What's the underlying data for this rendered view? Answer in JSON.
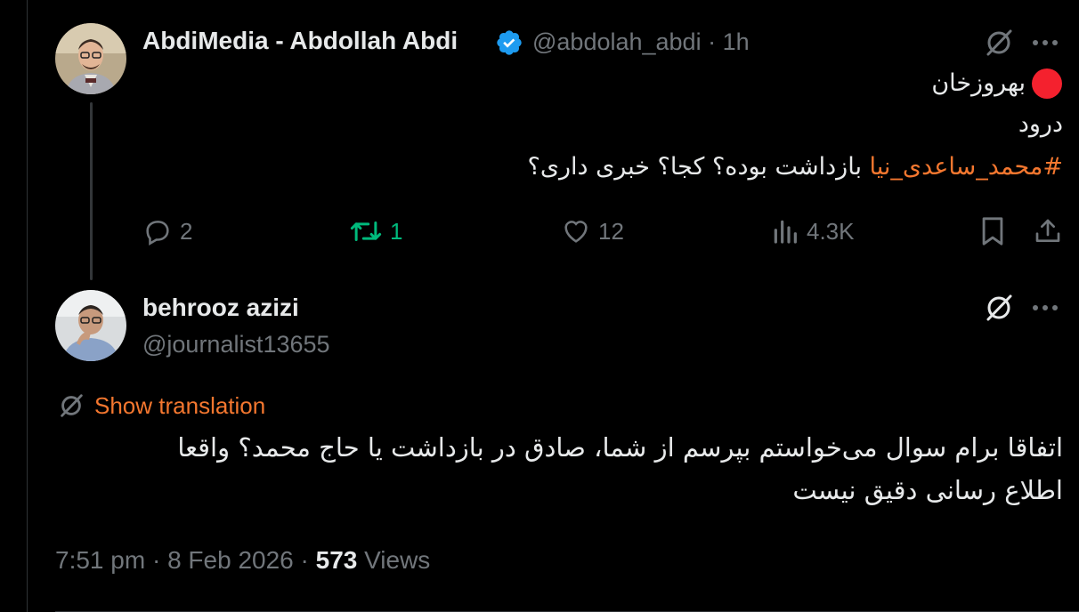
{
  "tweet1": {
    "author_name": "AbdiMedia - Abdollah Abdi",
    "handle": "@abdolah_abdi",
    "dot": "·",
    "time": "1h",
    "line1_name": "بهروزخان",
    "line2": "درود",
    "hashtag": "#محمد_ساعدی_نیا",
    "line3_rest": " بازداشت بوده؟ کجا؟ خبری داری؟",
    "actions": {
      "replies": "2",
      "reposts": "1",
      "likes": "12",
      "views": "4.3K"
    }
  },
  "tweet2": {
    "author_name": "behrooz azizi",
    "handle": "@journalist13655",
    "show_translation": "Show translation",
    "line1": "اتفاقا برام سوال می‌خواستم بپرسم از شما، صادق در بازداشت یا حاج محمد؟ واقعا",
    "line2": "اطلاع رسانی دقیق نیست",
    "time": "7:51 pm",
    "date": "8 Feb 2026",
    "views_count": "573",
    "views_label": "Views",
    "dot": "·"
  },
  "colors": {
    "background": "#000000",
    "text": "#e7e9ea",
    "muted": "#71767b",
    "accent_orange": "#f4772f",
    "verified_blue": "#1d9bf0",
    "repost_green": "#00ba7c",
    "record_red": "#f4212e"
  },
  "icons": [
    "grok-icon",
    "more-icon",
    "verified-badge-icon",
    "reply-icon",
    "repost-icon",
    "like-icon",
    "views-icon",
    "bookmark-icon",
    "share-icon",
    "translate-icon"
  ]
}
